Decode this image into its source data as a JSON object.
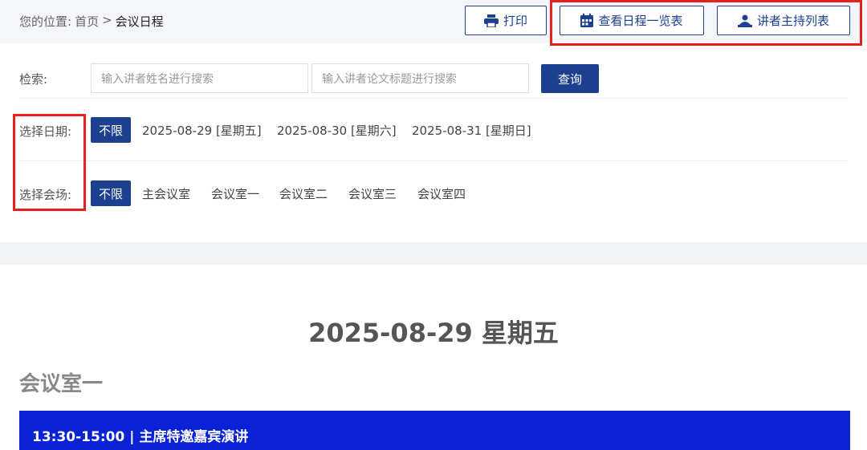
{
  "breadcrumb": {
    "prefix": "您的位置:",
    "home": "首页",
    "sep": ">",
    "current": "会议日程"
  },
  "toolbar": {
    "print": "打印",
    "schedule_list": "查看日程一览表",
    "speakers_list": "讲者主持列表"
  },
  "search": {
    "label": "检索:",
    "speaker_placeholder": "输入讲者姓名进行搜索",
    "paper_placeholder": "输入讲者论文标题进行搜索",
    "query_button": "查询"
  },
  "date_filter": {
    "label": "选择日期:",
    "options": [
      "不限",
      "2025-08-29 [星期五]",
      "2025-08-30 [星期六]",
      "2025-08-31 [星期日]"
    ]
  },
  "venue_filter": {
    "label": "选择会场:",
    "options": [
      "不限",
      "主会议室",
      "会议室一",
      "会议室二",
      "会议室三",
      "会议室四"
    ]
  },
  "schedule": {
    "day_title": "2025-08-29 星期五",
    "room_title": "会议室一",
    "session": "13:30-15:00 | 主席特邀嘉宾演讲"
  },
  "colors": {
    "primary": "#1c3f8f",
    "highlight": "#e5211e",
    "session_bar": "#0a22d6"
  }
}
